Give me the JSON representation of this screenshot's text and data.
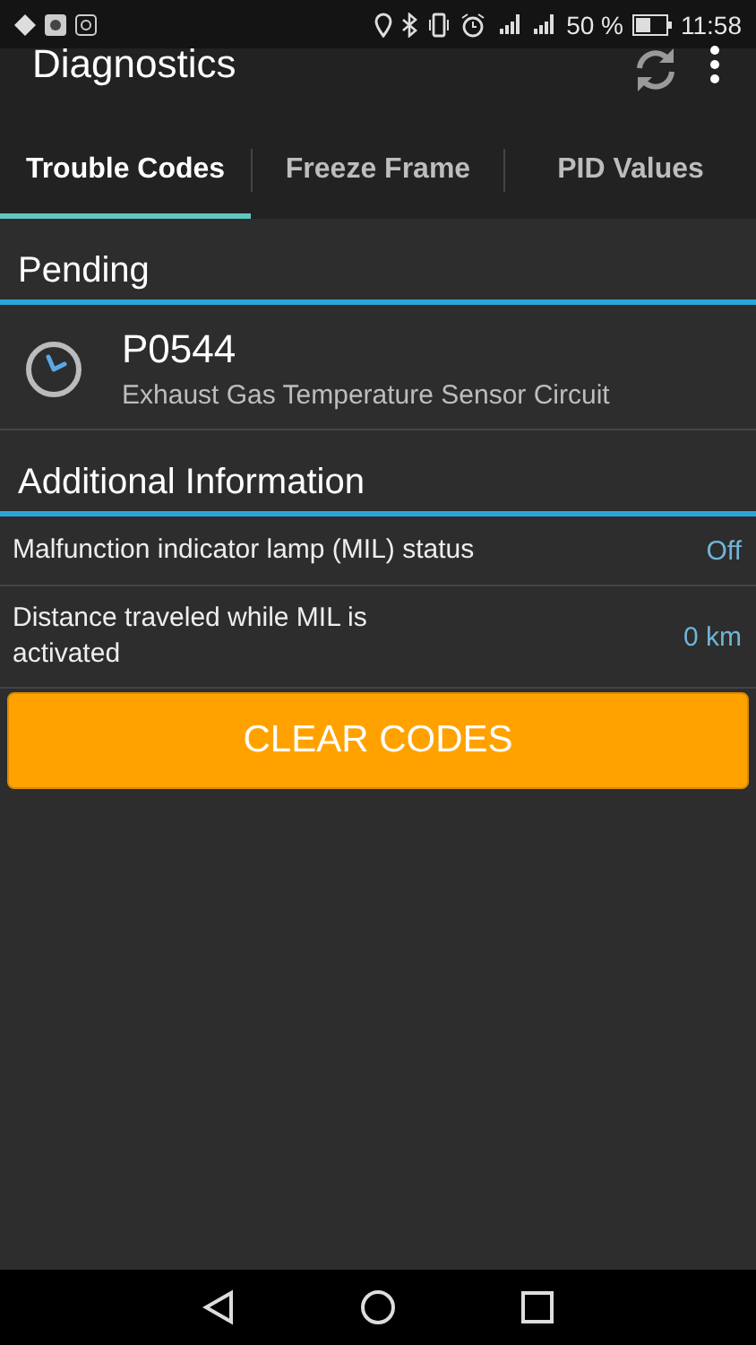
{
  "status_bar": {
    "battery_percent": "50 %",
    "time": "11:58"
  },
  "app_bar": {
    "title": "Diagnostics"
  },
  "tabs": [
    {
      "label": "Trouble Codes",
      "selected": true
    },
    {
      "label": "Freeze Frame",
      "selected": false
    },
    {
      "label": "PID Values",
      "selected": false
    }
  ],
  "pending": {
    "header": "Pending",
    "codes": [
      {
        "code": "P0544",
        "description": "Exhaust Gas Temperature Sensor Circuit"
      }
    ]
  },
  "additional": {
    "header": "Additional Information",
    "rows": [
      {
        "label": "Malfunction indicator lamp (MIL) status",
        "value": "Off"
      },
      {
        "label": "Distance traveled while MIL is activated",
        "value": "0 km"
      }
    ]
  },
  "clear_button": "CLEAR CODES"
}
